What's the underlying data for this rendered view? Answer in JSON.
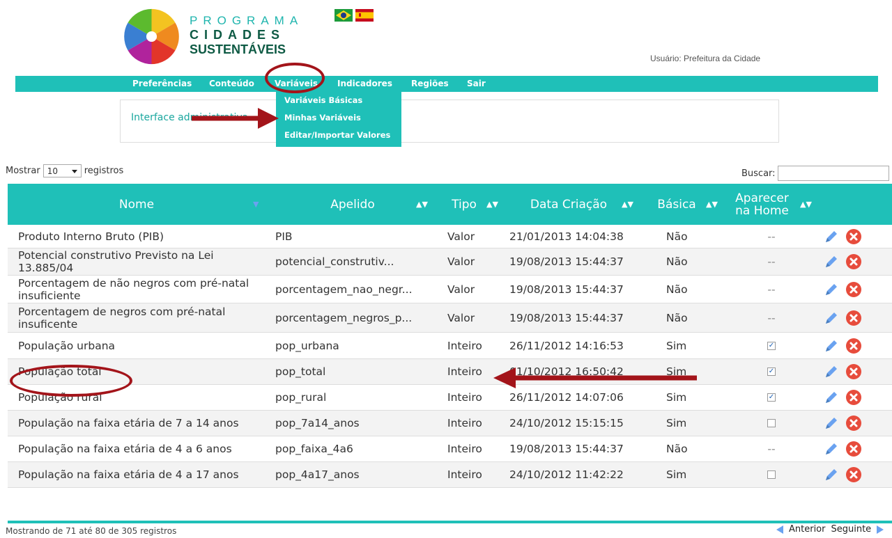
{
  "brand": {
    "line1": "PROGRAMA",
    "line2": "CIDADES",
    "line3": "SUSTENTÁVEIS"
  },
  "user": {
    "label": "Usuário: Prefeitura da Cidade"
  },
  "nav": {
    "items": [
      "Preferências",
      "Conteúdo",
      "Variáveis",
      "Indicadores",
      "Regiões",
      "Sair"
    ]
  },
  "dropdown": {
    "items": [
      "Variáveis Básicas",
      "Minhas Variáveis",
      "Editar/Importar Valores"
    ]
  },
  "admin": {
    "text": "Interface administrativa"
  },
  "table_controls": {
    "show_label": "Mostrar",
    "show_value": "10",
    "records_label": "registros",
    "search_label": "Buscar:"
  },
  "table": {
    "headers": {
      "nome": "Nome",
      "apelido": "Apelido",
      "tipo": "Tipo",
      "data": "Data Criação",
      "basica": "Básica",
      "home": "Aparecer na Home"
    },
    "rows": [
      {
        "nome": "Produto Interno Bruto (PIB)",
        "apelido": "PIB",
        "tipo": "Valor",
        "data": "21/01/2013 14:04:38",
        "basica": "Não",
        "home": "--"
      },
      {
        "nome": "Potencial construtivo Previsto na Lei 13.885/04",
        "apelido": "potencial_construtiv...",
        "tipo": "Valor",
        "data": "19/08/2013 15:44:37",
        "basica": "Não",
        "home": "--"
      },
      {
        "nome": "Porcentagem de não negros com pré-natal insuficiente",
        "apelido": "porcentagem_nao_negr...",
        "tipo": "Valor",
        "data": "19/08/2013 15:44:37",
        "basica": "Não",
        "home": "--"
      },
      {
        "nome": "Porcentagem de negros com pré-natal insuficente",
        "apelido": "porcentagem_negros_p...",
        "tipo": "Valor",
        "data": "19/08/2013 15:44:37",
        "basica": "Não",
        "home": "--"
      },
      {
        "nome": "População urbana",
        "apelido": "pop_urbana",
        "tipo": "Inteiro",
        "data": "26/11/2012 14:16:53",
        "basica": "Sim",
        "home": "checked"
      },
      {
        "nome": "População total",
        "apelido": "pop_total",
        "tipo": "Inteiro",
        "data": "01/10/2012 16:50:42",
        "basica": "Sim",
        "home": "checked"
      },
      {
        "nome": "População rural",
        "apelido": "pop_rural",
        "tipo": "Inteiro",
        "data": "26/11/2012 14:07:06",
        "basica": "Sim",
        "home": "checked"
      },
      {
        "nome": "População na faixa etária de 7 a 14 anos",
        "apelido": "pop_7a14_anos",
        "tipo": "Inteiro",
        "data": "24/10/2012 15:15:15",
        "basica": "Sim",
        "home": "unchecked"
      },
      {
        "nome": "População na faixa etária de 4 a 6 anos",
        "apelido": "pop_faixa_4a6",
        "tipo": "Inteiro",
        "data": "19/08/2013 15:44:37",
        "basica": "Não",
        "home": "--"
      },
      {
        "nome": "População na faixa etária de 4 a 17 anos",
        "apelido": "pop_4a17_anos",
        "tipo": "Inteiro",
        "data": "24/10/2012 11:42:22",
        "basica": "Sim",
        "home": "unchecked"
      }
    ]
  },
  "footer": {
    "info": "Mostrando de 71 até 80 de 305 registros",
    "prev": "Anterior",
    "next": "Seguinte"
  },
  "colors": {
    "accent": "#1fc0b8",
    "annotation": "#a3141a",
    "edit": "#6aa2f0",
    "delete": "#e74c3c"
  },
  "icons": [
    "pencil-icon",
    "delete-icon",
    "flag-brazil-icon",
    "flag-spain-icon"
  ]
}
